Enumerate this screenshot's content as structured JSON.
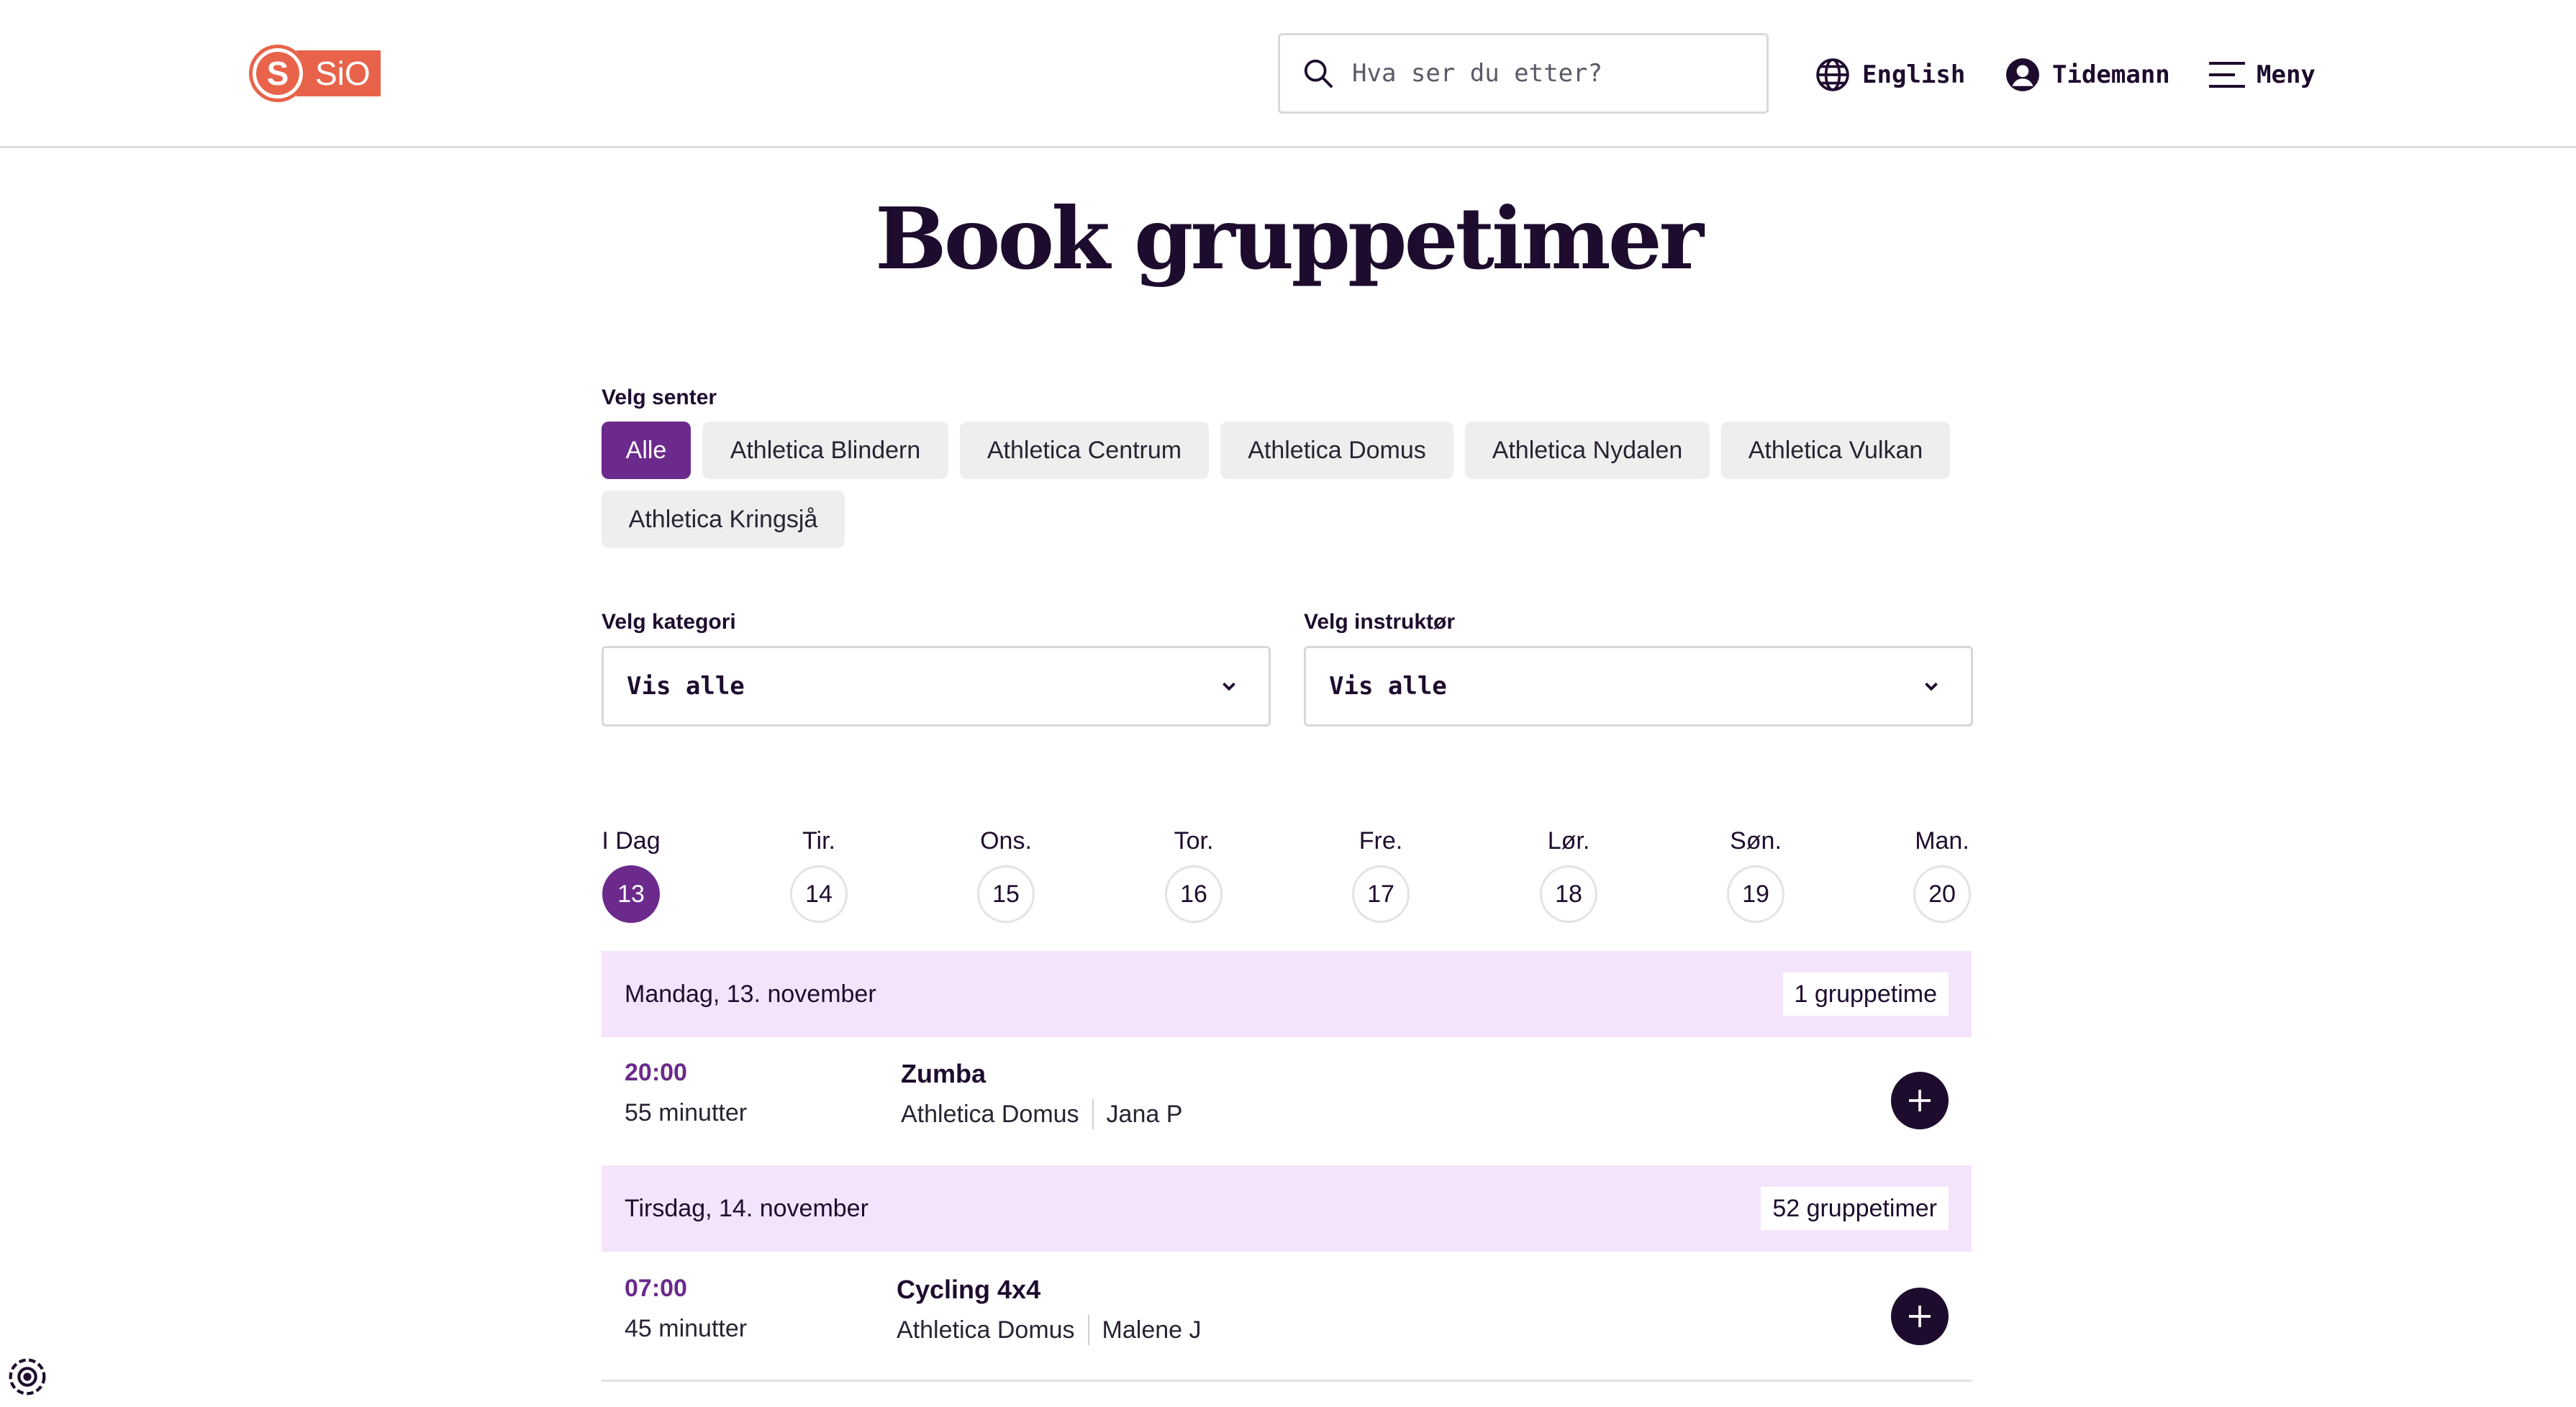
{
  "header": {
    "logo_text": "SiO",
    "logo_letter": "S",
    "search_placeholder": "Hva ser du etter?",
    "language": "English",
    "user": "Tidemann",
    "menu": "Meny",
    "icons": [
      "search-icon",
      "globe-icon",
      "user-icon",
      "hamburger-icon"
    ]
  },
  "page_title": "Book gruppetimer",
  "center_filter": {
    "label": "Velg senter",
    "options": [
      "Alle",
      "Athletica Blindern",
      "Athletica Centrum",
      "Athletica Domus",
      "Athletica Nydalen",
      "Athletica Vulkan",
      "Athletica Kringsjå"
    ],
    "selected": "Alle"
  },
  "category_filter": {
    "label": "Velg kategori",
    "value": "Vis alle"
  },
  "instructor_filter": {
    "label": "Velg instruktør",
    "value": "Vis alle"
  },
  "days": [
    {
      "name": "I Dag",
      "date": "13",
      "active": true
    },
    {
      "name": "Tir.",
      "date": "14"
    },
    {
      "name": "Ons.",
      "date": "15"
    },
    {
      "name": "Tor.",
      "date": "16"
    },
    {
      "name": "Fre.",
      "date": "17"
    },
    {
      "name": "Lør.",
      "date": "18"
    },
    {
      "name": "Søn.",
      "date": "19"
    },
    {
      "name": "Man.",
      "date": "20"
    }
  ],
  "schedule": [
    {
      "date_label": "Mandag, 13. november",
      "count_label": "1 gruppetime",
      "classes": [
        {
          "time": "20:00",
          "duration": "55 minutter",
          "name": "Zumba",
          "center": "Athletica Domus",
          "instructor": "Jana P"
        }
      ]
    },
    {
      "date_label": "Tirsdag, 14. november",
      "count_label": "52 gruppetimer",
      "classes": [
        {
          "time": "07:00",
          "duration": "45 minutter",
          "name": "Cycling 4x4",
          "center": "Athletica Domus",
          "instructor": "Malene J"
        }
      ]
    }
  ],
  "colors": {
    "accent": "#6b2a8c",
    "dark": "#1e0c2e",
    "brand": "#e8634a",
    "day_band": "#f3e4fb"
  }
}
